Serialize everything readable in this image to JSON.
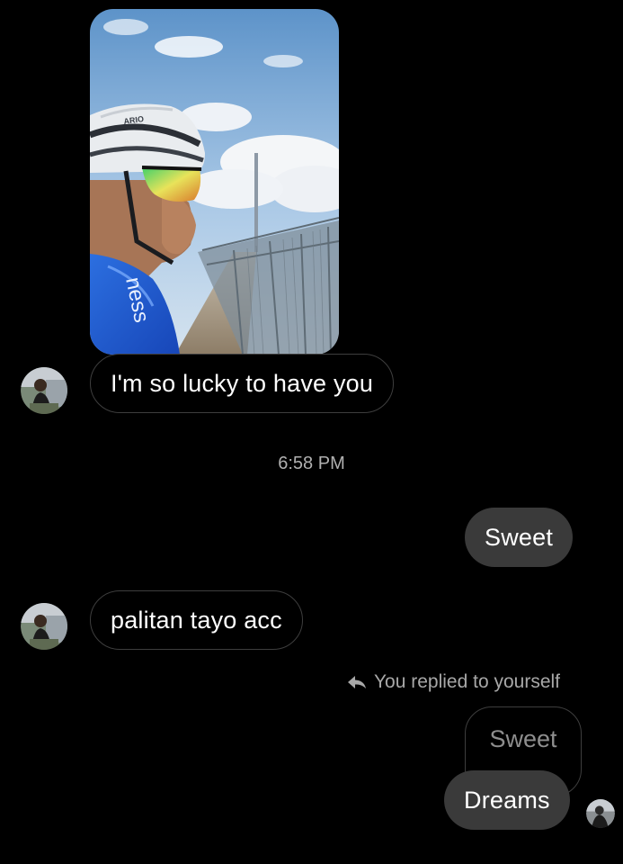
{
  "conversation": {
    "messages": [
      {
        "text": "I'm so lucky to have you"
      },
      {
        "text": "Sweet"
      },
      {
        "text": "palitan tayo acc"
      }
    ],
    "timestamp": "6:58 PM",
    "reply": {
      "note": "You replied to yourself",
      "quoted_text": "Sweet",
      "text": "Dreams"
    },
    "photo": {
      "jersey_text": "ness",
      "helmet_text": "ARIO"
    }
  },
  "colors": {
    "background": "#000000",
    "outgoing_bubble": "#3a3a3a",
    "incoming_border": "#3e3e3e",
    "meta_text": "#b0b0b0"
  },
  "icons": {
    "reply": "reply-arrow-icon"
  }
}
